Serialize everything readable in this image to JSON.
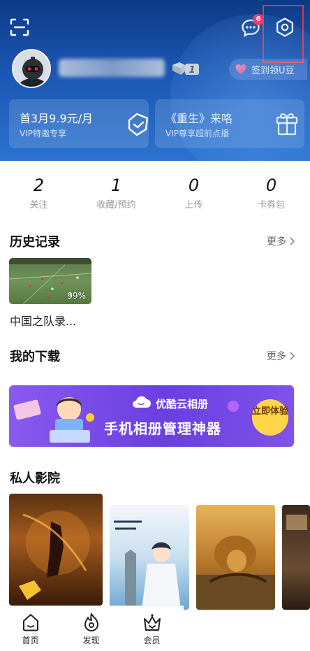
{
  "header": {
    "message_badge": "6",
    "signin_label": "签到领U豆",
    "level": "1"
  },
  "vip_cards": [
    {
      "title": "首3月9.9元/月",
      "subtitle": "VIP特邀专享"
    },
    {
      "title": "《重生》来咯",
      "subtitle": "VIP尊享超前点播"
    }
  ],
  "stats": [
    {
      "value": "2",
      "label": "关注"
    },
    {
      "value": "1",
      "label": "收藏/预约"
    },
    {
      "value": "0",
      "label": "上传"
    },
    {
      "value": "0",
      "label": "卡券包"
    }
  ],
  "history": {
    "title": "历史记录",
    "more": "更多",
    "items": [
      {
        "name": "中国之队录...",
        "progress": "99%"
      }
    ]
  },
  "downloads": {
    "title": "我的下载",
    "more": "更多",
    "banner": {
      "brand": "优酷云相册",
      "slogan": "手机相册管理神器",
      "cta": "立即体验"
    }
  },
  "cinema": {
    "title": "私人影院"
  },
  "bottom_nav": [
    {
      "label": "首页",
      "icon": "home-icon"
    },
    {
      "label": "发现",
      "icon": "discover-icon"
    },
    {
      "label": "会员",
      "icon": "crown-icon"
    }
  ],
  "colors": {
    "header_top": "#0d3a86",
    "header_bottom": "#2b73cf",
    "badge": "#ff2d55",
    "highlight_box": "#e8333a",
    "banner_purple": "#6a3fe0",
    "cta_yellow": "#ffd54a"
  }
}
